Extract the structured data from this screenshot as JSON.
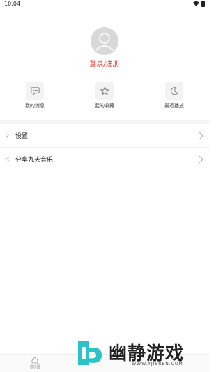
{
  "status_bar": {
    "time": "10:04"
  },
  "profile": {
    "login_label": "登录/注册"
  },
  "quick_actions": [
    {
      "label": "我的消息",
      "icon": "message-icon"
    },
    {
      "label": "我的收藏",
      "icon": "star-icon"
    },
    {
      "label": "最近播放",
      "icon": "moon-icon"
    }
  ],
  "menu": [
    {
      "label": "设置",
      "icon": "pin-icon"
    },
    {
      "label": "分享九天音乐",
      "icon": "share-icon"
    }
  ],
  "tab_bar": {
    "home_label": "音乐圈"
  },
  "watermark": {
    "brand": "幽静游戏",
    "url": "— WWW.YJISREN.COM —"
  },
  "colors": {
    "accent": "#e8251a",
    "background": "#ffffff",
    "divider": "#f4f4f4",
    "watermark_teal": "#29c3c8"
  }
}
